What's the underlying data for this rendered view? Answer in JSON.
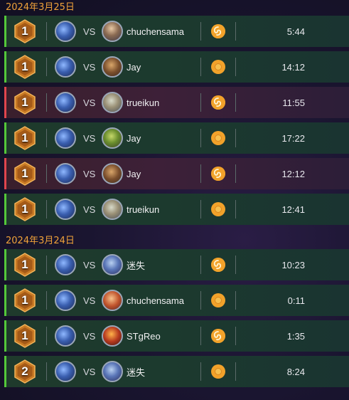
{
  "groups": [
    {
      "date": "2024年3月25日",
      "matches": [
        {
          "result": "win",
          "rank": "1",
          "vs": "VS",
          "opponent": "chuchensama",
          "opp_avatar": "o1",
          "mode": "swirl",
          "time": "5:44"
        },
        {
          "result": "win",
          "rank": "1",
          "vs": "VS",
          "opponent": "Jay",
          "opp_avatar": "o2",
          "mode": "coin",
          "time": "14:12"
        },
        {
          "result": "loss",
          "rank": "1",
          "vs": "VS",
          "opponent": "trueikun",
          "opp_avatar": "o3",
          "mode": "swirl",
          "time": "11:55"
        },
        {
          "result": "win",
          "rank": "1",
          "vs": "VS",
          "opponent": "Jay",
          "opp_avatar": "o4",
          "mode": "coin",
          "time": "17:22"
        },
        {
          "result": "loss",
          "rank": "1",
          "vs": "VS",
          "opponent": "Jay",
          "opp_avatar": "o2",
          "mode": "swirl",
          "time": "12:12"
        },
        {
          "result": "win",
          "rank": "1",
          "vs": "VS",
          "opponent": "trueikun",
          "opp_avatar": "o3",
          "mode": "coin",
          "time": "12:41"
        }
      ]
    },
    {
      "date": "2024年3月24日",
      "matches": [
        {
          "result": "win",
          "rank": "1",
          "vs": "VS",
          "opponent": "迷失",
          "opp_avatar": "o5",
          "mode": "swirl",
          "time": "10:23"
        },
        {
          "result": "win",
          "rank": "1",
          "vs": "VS",
          "opponent": "chuchensama",
          "opp_avatar": "o6",
          "mode": "coin",
          "time": "0:11"
        },
        {
          "result": "win",
          "rank": "1",
          "vs": "VS",
          "opponent": "STgReo",
          "opp_avatar": "o7",
          "mode": "swirl",
          "time": "1:35"
        },
        {
          "result": "win",
          "rank": "2",
          "vs": "VS",
          "opponent": "迷失",
          "opp_avatar": "o5",
          "mode": "coin",
          "time": "8:24"
        }
      ]
    }
  ],
  "colors": {
    "accent_date": "#f0a23a",
    "win": "#54c83a",
    "loss": "#e0454d",
    "mode": "#f2a22a"
  }
}
